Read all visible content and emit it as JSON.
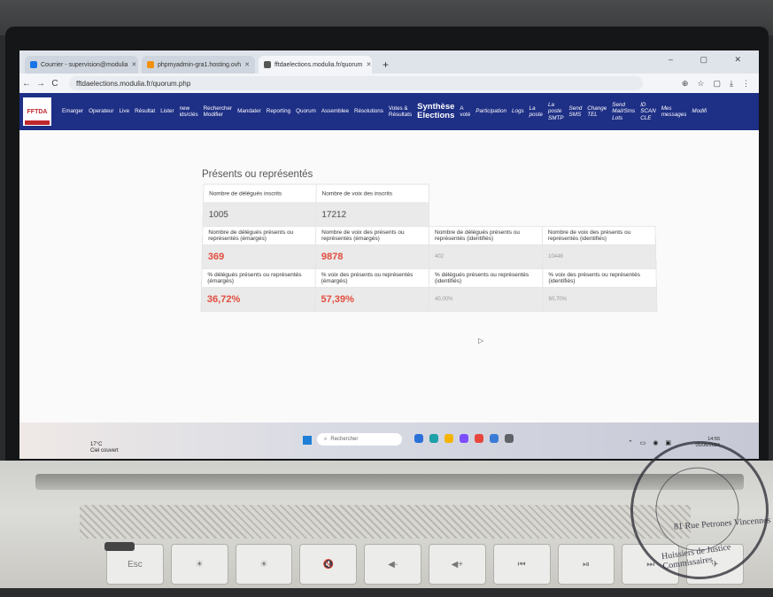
{
  "browser": {
    "tabs": [
      {
        "label": "Courrier - supervision@modulia",
        "favicon_color": "#1a73e8",
        "active": false
      },
      {
        "label": "phpmyadmin-gra1.hosting.ovh",
        "favicon_color": "#f29111",
        "active": false
      },
      {
        "label": "fftdaelections.modulia.fr/quorum",
        "favicon_color": "#555555",
        "active": true
      }
    ],
    "url": "fftdaelections.modulia.fr/quorum.php",
    "new_tab": "+",
    "window_controls": "– ▢ ✕",
    "back_icon": "←",
    "forward_icon": "→",
    "reload_icon": "C",
    "right_icons": [
      "⊕",
      "☆",
      "▢",
      "⤓",
      "⋮"
    ]
  },
  "app": {
    "logo_text": "FFTDA",
    "nav": [
      {
        "label": "Emarger",
        "name": "nav-emarger"
      },
      {
        "label": "Operateur",
        "name": "nav-operateur"
      },
      {
        "label": "Live",
        "name": "nav-live"
      },
      {
        "label": "Résultat",
        "name": "nav-resultat"
      },
      {
        "label": "Lister",
        "name": "nav-lister"
      },
      {
        "label": "new\nids/clés",
        "name": "nav-new-ids"
      },
      {
        "label": "Rechercher\nModifier",
        "name": "nav-rechercher"
      },
      {
        "label": "Mandater",
        "name": "nav-mandater"
      },
      {
        "label": "Reporting",
        "name": "nav-reporting"
      },
      {
        "label": "Quorum",
        "name": "nav-quorum"
      },
      {
        "label": "Assemblee",
        "name": "nav-assemblee"
      },
      {
        "label": "Résolutions",
        "name": "nav-resolutions"
      },
      {
        "label": "Votes &\nRésultats",
        "name": "nav-votes"
      },
      {
        "label": "Synthèse\nElections",
        "name": "nav-synthese",
        "big": true
      },
      {
        "label": "A\nvoté",
        "name": "nav-a-vote"
      },
      {
        "label": "Participation",
        "name": "nav-participation",
        "italic": true
      },
      {
        "label": "Logs",
        "name": "nav-logs",
        "italic": true
      },
      {
        "label": "La\nposte",
        "name": "nav-la-poste",
        "italic": true
      },
      {
        "label": "La\nposte\nSMTP",
        "name": "nav-la-poste-smtp",
        "italic": true
      },
      {
        "label": "Send\nSMS",
        "name": "nav-send-sms",
        "italic": true
      },
      {
        "label": "Change\nTEL",
        "name": "nav-change-tel",
        "italic": true
      },
      {
        "label": "Send\nMail/Sms\nLots",
        "name": "nav-send-mail",
        "italic": true
      },
      {
        "label": "ID\nSCAN\nCLE",
        "name": "nav-id-scan",
        "italic": true
      },
      {
        "label": "Mes\nmessages",
        "name": "nav-mes-messages",
        "italic": true
      },
      {
        "label": "Modifi",
        "name": "nav-modifier",
        "italic": true
      }
    ]
  },
  "quorum": {
    "title": "Présents ou représentés",
    "labels": {
      "inscrits": "Nombre de délégués inscrits",
      "voix_inscrits": "Nombre de voix des inscrits",
      "presents_emarges": "Nombre de délégués présents ou représentés (émargés)",
      "voix_emarges": "Nombre de voix des présents ou représentés (émargés)",
      "presents_identifies": "Nombre de délégués présents ou représentés (identifiés)",
      "voix_identifies": "Nombre de voix des présents ou représentés (identifiés)",
      "pct_delegues_emarges": "% délégués présents ou représentés (émargés)",
      "pct_voix_emarges": "% voix des présents ou représentés (émargés)",
      "pct_delegues_identifies": "% délégués présents ou représentés (identifiés)",
      "pct_voix_identifies": "% voix des présents ou représentés (identifiés)"
    },
    "values": {
      "inscrits": "1005",
      "voix_inscrits": "17212",
      "presents_emarges": "369",
      "voix_emarges": "9878",
      "presents_identifies": "402",
      "voix_identifies": "10448",
      "pct_delegues_emarges": "36,72%",
      "pct_voix_emarges": "57,39%",
      "pct_delegues_identifies": "40,00%",
      "pct_voix_identifies": "60,70%"
    }
  },
  "taskbar": {
    "weather_temp": "17°C",
    "weather_desc": "Ciel couvert",
    "search_placeholder": "Rechercher",
    "time": "14:55",
    "date": "05/06/2024",
    "app_colors": [
      "#2b6fd8",
      "#1ea0a8",
      "#f4b400",
      "#7c4dff",
      "#e8453c",
      "#3a7bd5",
      "#5f6368"
    ],
    "tray_colors": [
      "#2d7ff9",
      "#cfcfcf",
      "#3fb950",
      "#8ab4f8",
      "#b9b9b9",
      "#f28b30",
      "#dddddd",
      "#6ea8fe",
      "#4caf50",
      "#9aa0a6"
    ]
  },
  "laptop": {
    "stamp_line1": "81 Rue Petrones Vincennes",
    "stamp_line2": "Huissiers de Justice Commissaires",
    "keys": [
      "Esc",
      "☀",
      "☀",
      "🔇",
      "◀-",
      "◀+",
      "⏮",
      "⏯",
      "⏭",
      "✈"
    ]
  }
}
